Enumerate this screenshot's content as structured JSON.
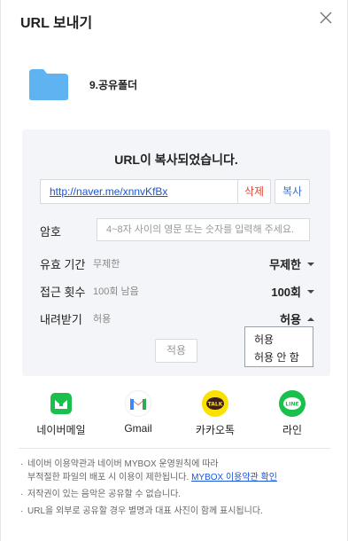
{
  "dialog": {
    "title": "URL 보내기",
    "close_icon": "close-icon"
  },
  "folder": {
    "icon": "folder-icon",
    "name": "9.공유폴더",
    "color": "#5fb3f0"
  },
  "panel": {
    "copied_message": "URL이 복사되었습니다.",
    "url": "http://naver.me/xnnvKfBx",
    "delete_label": "삭제",
    "copy_label": "복사",
    "password": {
      "label": "암호",
      "placeholder": "4~8자 사이의 영문 또는 숫자를 입력해 주세요."
    },
    "validity": {
      "label": "유효 기간",
      "sub": "무제한",
      "value": "무제한"
    },
    "access_count": {
      "label": "접근 횟수",
      "sub": "100회 남음",
      "value": "100회"
    },
    "download": {
      "label": "내려받기",
      "sub": "허용",
      "value": "허용",
      "options": [
        "허용",
        "허용 안 함"
      ]
    },
    "apply_label": "적용"
  },
  "share_targets": [
    {
      "label": "네이버메일",
      "icon": "naver-mail-icon",
      "color": "#19c04b"
    },
    {
      "label": "Gmail",
      "icon": "gmail-icon",
      "color": "#ea4335"
    },
    {
      "label": "카카오톡",
      "icon": "kakaotalk-icon",
      "color": "#fae100",
      "icon_text": "TALK"
    },
    {
      "label": "라인",
      "icon": "line-icon",
      "color": "#19c04b",
      "icon_text": "LINE"
    }
  ],
  "notes": {
    "line1": "네이버 이용약관과 네이버 MYBOX 운영원칙에 따라",
    "line2": "부적절한 파일의 배포 시 이용이 제한됩니다.",
    "link": "MYBOX 이용약관 확인",
    "line3": "저작권이 있는 음악은 공유할 수 없습니다.",
    "line4": "URL을 외부로 공유할 경우 별명과 대표 사진이 함께 표시됩니다."
  }
}
